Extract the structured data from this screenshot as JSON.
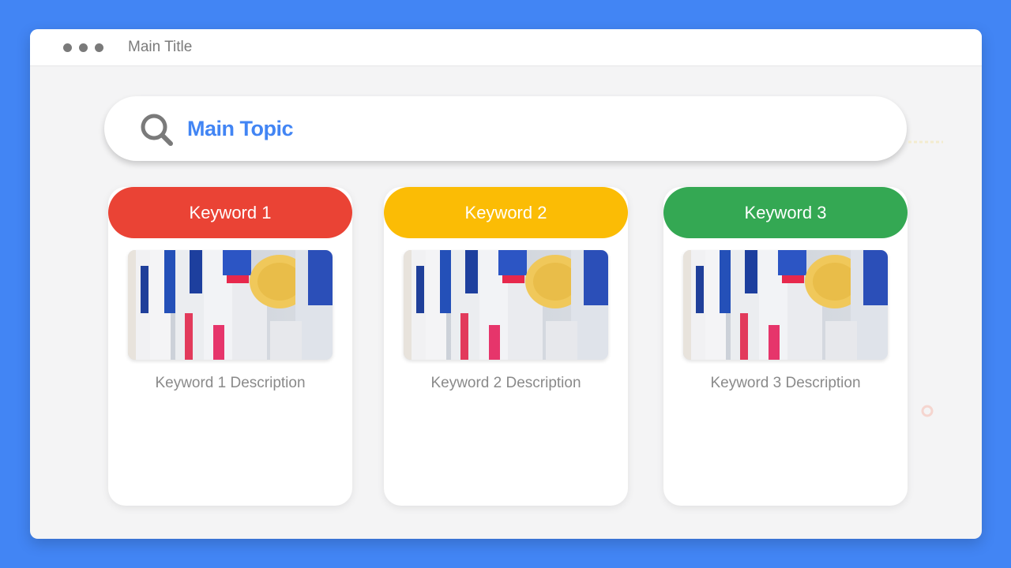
{
  "window": {
    "title": "Main Title"
  },
  "search": {
    "value": "Main Topic"
  },
  "cards": [
    {
      "keyword": "Keyword 1",
      "description": "Keyword 1 Description",
      "color": "#ea4335"
    },
    {
      "keyword": "Keyword 2",
      "description": "Keyword 2 Description",
      "color": "#fbbc05"
    },
    {
      "keyword": "Keyword 3",
      "description": "Keyword 3 Description",
      "color": "#34a853"
    }
  ],
  "colors": {
    "background": "#4285f4",
    "accent": "#4285f4",
    "window": "#f4f4f5"
  },
  "icons": {
    "search": "search-icon",
    "window_controls": "window-dots-icon"
  }
}
